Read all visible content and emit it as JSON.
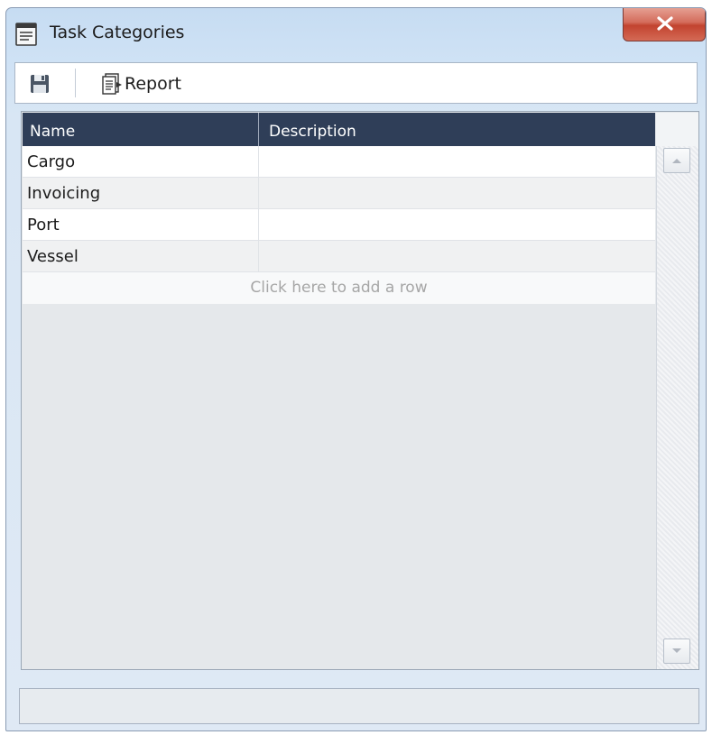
{
  "window": {
    "title": "Task Categories",
    "title_icon": "form-window-icon",
    "close_icon": "close-icon"
  },
  "toolbar": {
    "save_icon": "save-icon",
    "report_label": "Report",
    "report_icon": "report-icon"
  },
  "grid": {
    "columns": [
      "Name",
      "Description"
    ],
    "rows": [
      {
        "name": "Cargo",
        "description": ""
      },
      {
        "name": "Invoicing",
        "description": ""
      },
      {
        "name": "Port",
        "description": ""
      },
      {
        "name": "Vessel",
        "description": ""
      }
    ],
    "add_row_text": "Click here to add a row"
  },
  "colors": {
    "header_bg": "#2f3e58",
    "close_button": "#c2432f",
    "window_frame": "#c6dcf2"
  }
}
